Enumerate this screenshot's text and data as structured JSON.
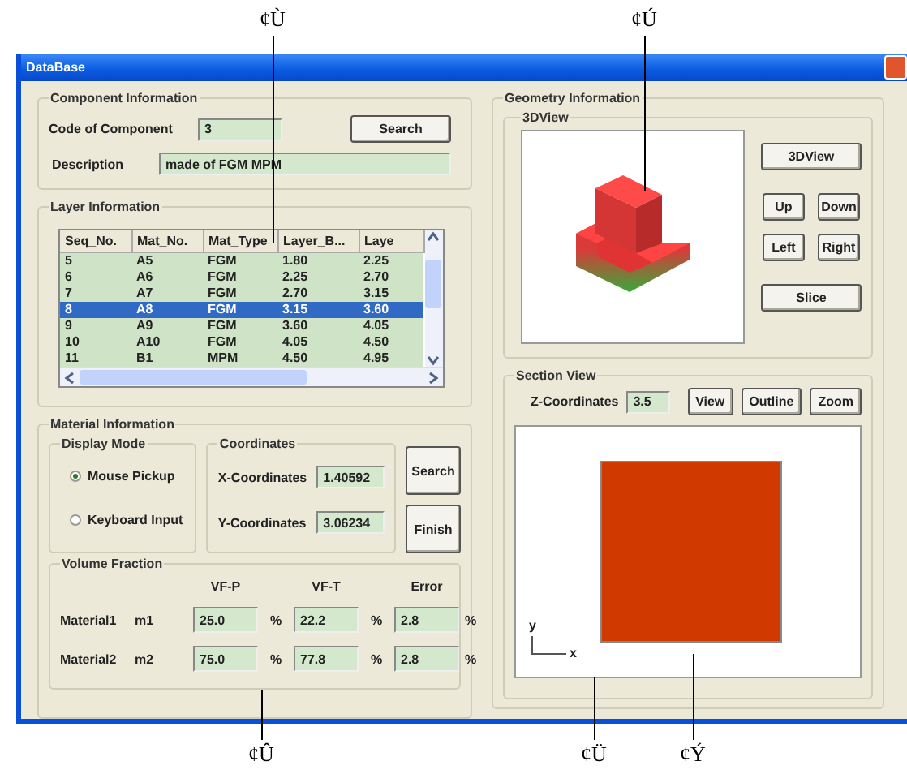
{
  "window": {
    "title": "DataBase"
  },
  "component_information": {
    "title": "Component Information",
    "code_label": "Code of Component",
    "code_value": "3",
    "search_button": "Search",
    "description_label": "Description",
    "description_value": "made of FGM MPM"
  },
  "layer_information": {
    "title": "Layer Information",
    "columns": [
      "Seq_No.",
      "Mat_No.",
      "Mat_Type",
      "Layer_B...",
      "Laye"
    ],
    "rows": [
      {
        "cells": [
          "5",
          "A5",
          "FGM",
          "1.80",
          "2.25"
        ],
        "selected": false
      },
      {
        "cells": [
          "6",
          "A6",
          "FGM",
          "2.25",
          "2.70"
        ],
        "selected": false
      },
      {
        "cells": [
          "7",
          "A7",
          "FGM",
          "2.70",
          "3.15"
        ],
        "selected": false
      },
      {
        "cells": [
          "8",
          "A8",
          "FGM",
          "3.15",
          "3.60"
        ],
        "selected": true
      },
      {
        "cells": [
          "9",
          "A9",
          "FGM",
          "3.60",
          "4.05"
        ],
        "selected": false
      },
      {
        "cells": [
          "10",
          "A10",
          "FGM",
          "4.05",
          "4.50"
        ],
        "selected": false
      },
      {
        "cells": [
          "11",
          "B1",
          "MPM",
          "4.50",
          "4.95"
        ],
        "selected": false
      }
    ]
  },
  "material_information": {
    "title": "Material Information",
    "display_mode": {
      "title": "Display Mode",
      "options": [
        {
          "label": "Mouse Pickup",
          "selected": true
        },
        {
          "label": "Keyboard Input",
          "selected": false
        }
      ]
    },
    "coordinates": {
      "title": "Coordinates",
      "fields": [
        {
          "label": "X-Coordinates",
          "value": "1.40592"
        },
        {
          "label": "Y-Coordinates",
          "value": "3.06234"
        }
      ]
    },
    "buttons": [
      "Search",
      "Finish"
    ],
    "volume_fraction": {
      "title": "Volume Fraction",
      "columns": [
        "VF-P",
        "VF-T",
        "Error"
      ],
      "rows": [
        {
          "label": "Material1",
          "name": "m1",
          "values": [
            {
              "value": "25.0",
              "unit": "%"
            },
            {
              "value": "22.2",
              "unit": "%"
            },
            {
              "value": "2.8",
              "unit": "%"
            }
          ]
        },
        {
          "label": "Material2",
          "name": "m2",
          "values": [
            {
              "value": "75.0",
              "unit": "%"
            },
            {
              "value": "77.8",
              "unit": "%"
            },
            {
              "value": "2.8",
              "unit": "%"
            }
          ]
        }
      ]
    }
  },
  "geometry_information": {
    "title": "Geometry Information",
    "view_3d": {
      "title": "3DView",
      "buttons": [
        "3DView",
        "Up",
        "Down",
        "Left",
        "Right",
        "Slice"
      ]
    },
    "section_view": {
      "title": "Section View",
      "z_label": "Z-Coordinates",
      "z_value": "3.5",
      "buttons": [
        "View",
        "Outline",
        "Zoom"
      ],
      "axis_labels": [
        "y",
        "x"
      ]
    }
  },
  "callouts": [
    {
      "label": "¢Ù"
    },
    {
      "label": "¢Ú"
    },
    {
      "label": "¢Û"
    },
    {
      "label": "¢Ü"
    },
    {
      "label": "¢Ý"
    }
  ]
}
